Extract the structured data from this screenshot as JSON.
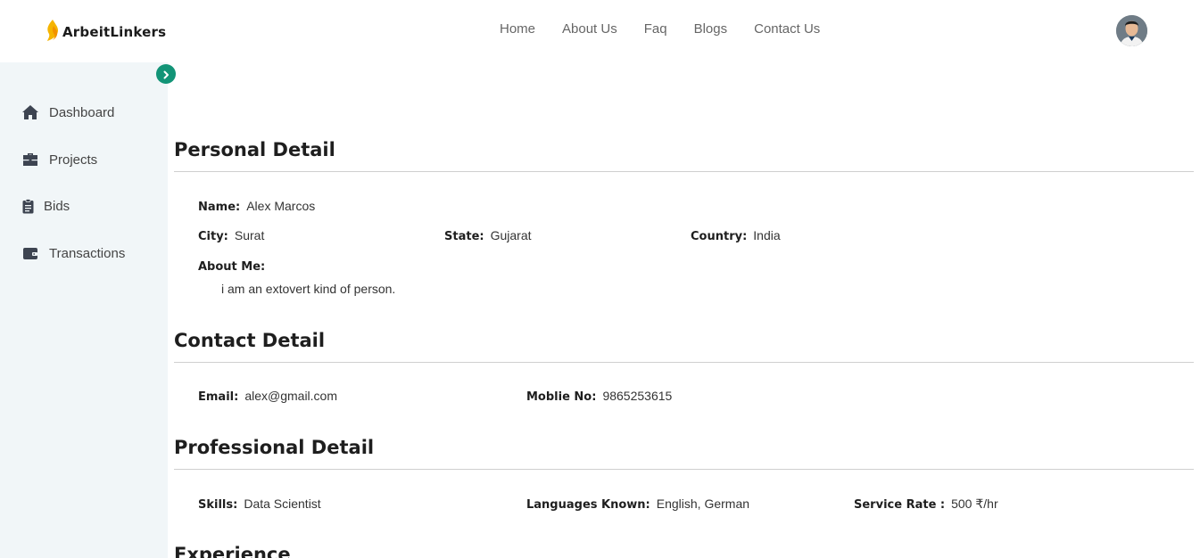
{
  "header": {
    "brand": "ArbeitLinkers",
    "nav": [
      "Home",
      "About Us",
      "Faq",
      "Blogs",
      "Contact Us"
    ]
  },
  "sidebar": {
    "items": [
      {
        "label": "Dashboard",
        "icon": "home-icon"
      },
      {
        "label": "Projects",
        "icon": "briefcase-icon"
      },
      {
        "label": "Bids",
        "icon": "clipboard-icon"
      },
      {
        "label": "Transactions",
        "icon": "wallet-icon"
      }
    ],
    "toggle_icon": "chevron-right-icon",
    "accent_color": "#129477"
  },
  "personal": {
    "title": "Personal Detail",
    "name_label": "Name:",
    "name": "Alex Marcos",
    "city_label": "City:",
    "city": "Surat",
    "state_label": "State:",
    "state": "Gujarat",
    "country_label": "Country:",
    "country": "India",
    "about_label": "About Me:",
    "about": "i am an extovert kind of person."
  },
  "contact": {
    "title": "Contact Detail",
    "email_label": "Email:",
    "email": "alex@gmail.com",
    "mobile_label": "Moblie No:",
    "mobile": "9865253615"
  },
  "professional": {
    "title": "Professional Detail",
    "skills_label": "Skills:",
    "skills": "Data Scientist",
    "languages_label": "Languages Known:",
    "languages": "English, German",
    "rate_label": "Service Rate :",
    "rate": "500 ₹/hr"
  },
  "experience": {
    "title": "Experience"
  }
}
